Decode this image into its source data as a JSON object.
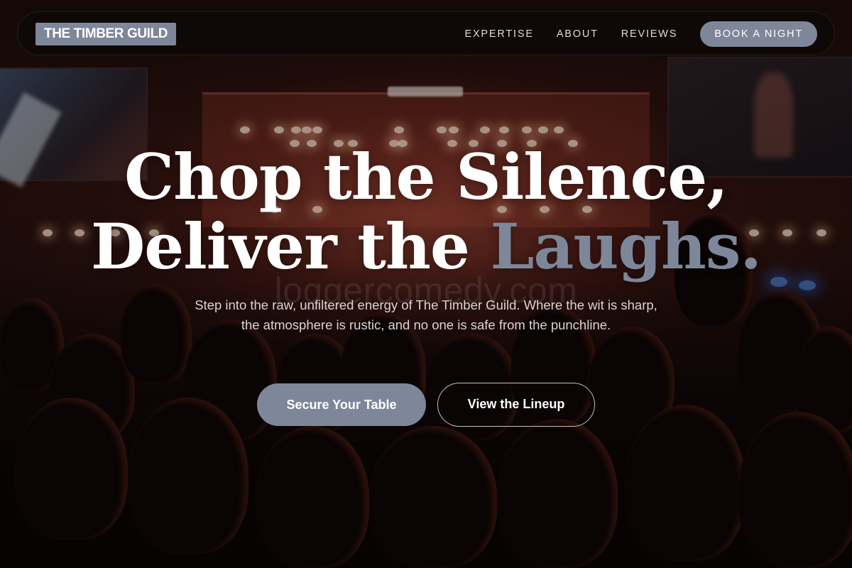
{
  "header": {
    "brand": "THE TIMBER GUILD",
    "nav_links": [
      "EXPERTISE",
      "ABOUT",
      "REVIEWS"
    ],
    "cta": "BOOK A NIGHT"
  },
  "hero": {
    "title_line1": "Chop the Silence,",
    "title_line2_plain": "Deliver the ",
    "title_line2_accent": "Laughs.",
    "watermark": "loggercomedy.com",
    "subtitle": "Step into the raw, unfiltered energy of The Timber Guild. Where the wit is sharp, the atmosphere is rustic, and no one is safe from the punchline.",
    "primary_button": "Secure Your Table",
    "secondary_button": "View the Lineup"
  },
  "colors": {
    "accent": "#7d8799",
    "text": "#ffffff",
    "background": "#1c0d0b"
  }
}
